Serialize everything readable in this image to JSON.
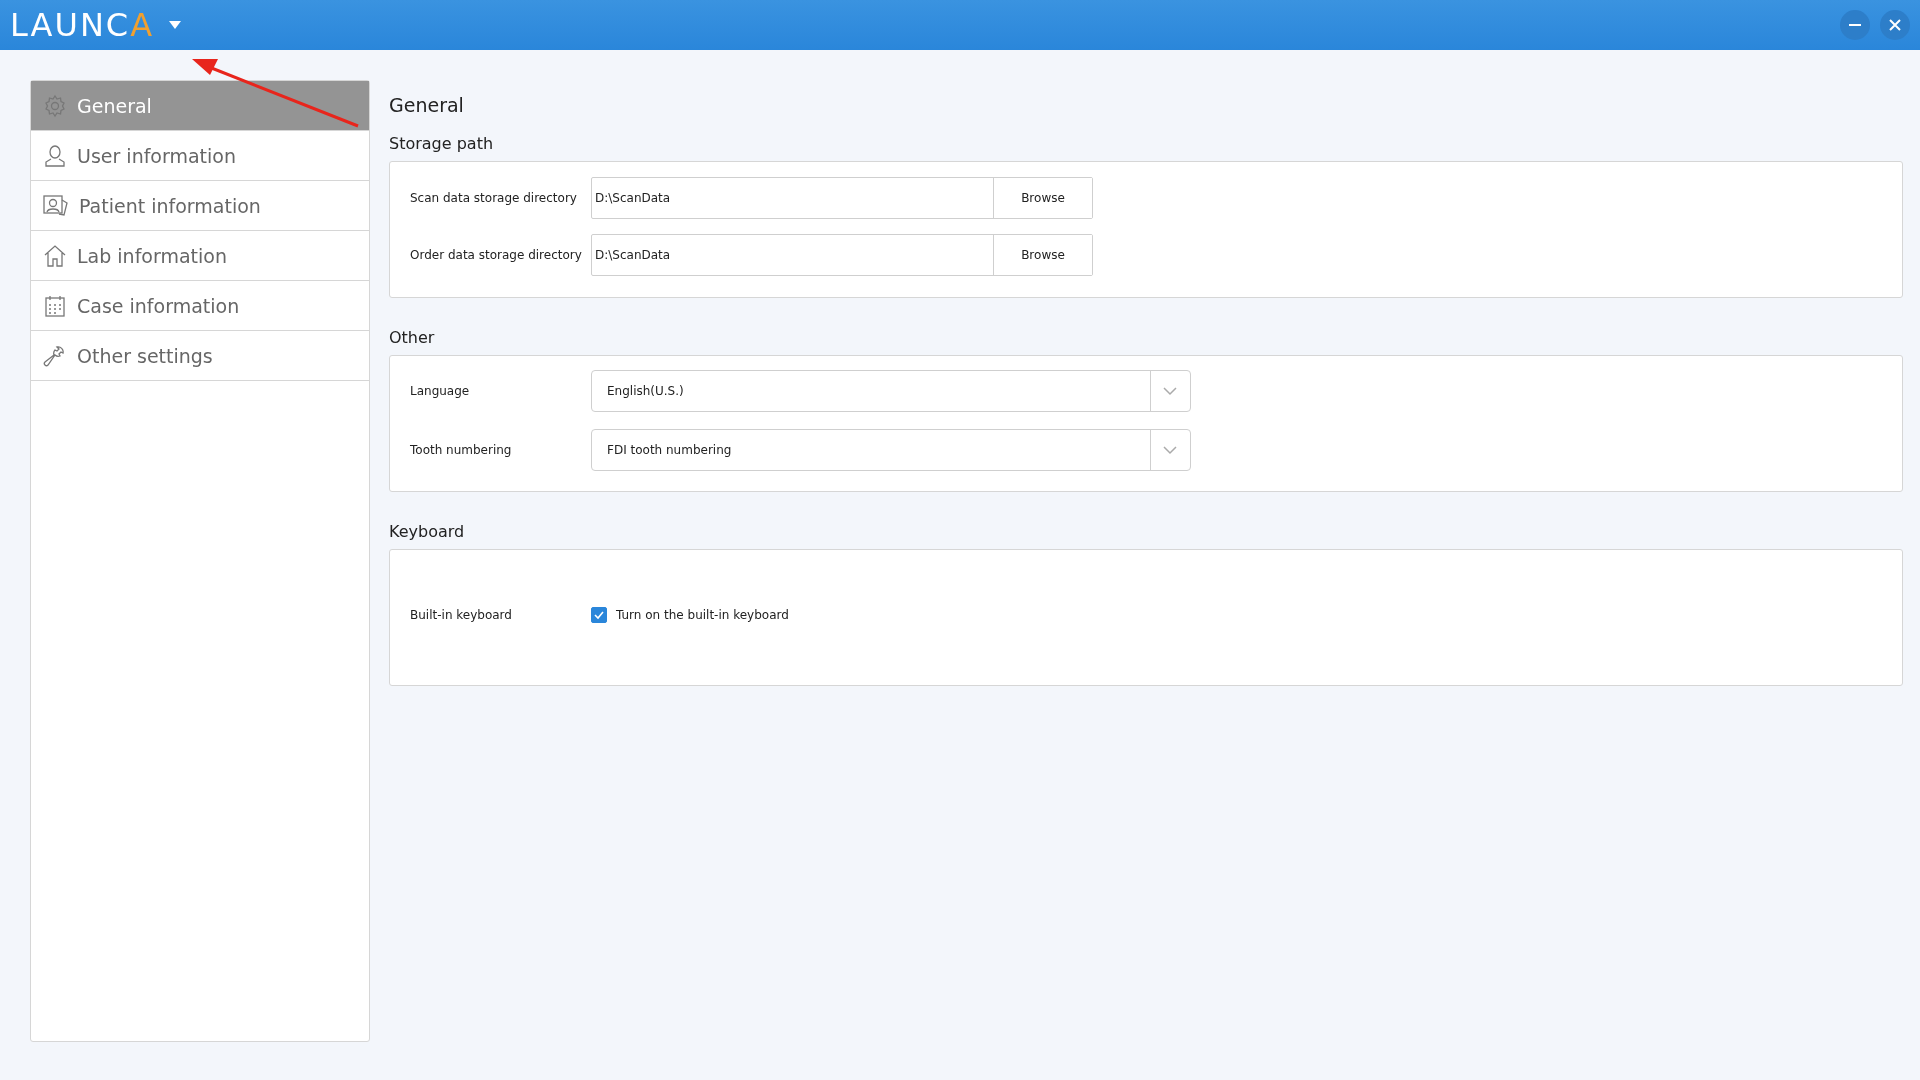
{
  "header": {
    "logo_main": "LAUNC",
    "logo_accent": "A"
  },
  "sidebar": {
    "items": [
      {
        "label": "General",
        "selected": true
      },
      {
        "label": "User information",
        "selected": false
      },
      {
        "label": "Patient information",
        "selected": false
      },
      {
        "label": "Lab information",
        "selected": false
      },
      {
        "label": "Case information",
        "selected": false
      },
      {
        "label": "Other settings",
        "selected": false
      }
    ]
  },
  "page_title": "General",
  "sections": [
    {
      "title": "Storage path",
      "rows": [
        {
          "kind": "path",
          "label": "Scan data storage directory",
          "value": "D:\\ScanData",
          "button": "Browse"
        },
        {
          "kind": "path",
          "label": "Order data storage directory",
          "value": "D:\\ScanData",
          "button": "Browse"
        }
      ]
    },
    {
      "title": "Other",
      "rows": [
        {
          "kind": "select",
          "label": "Language",
          "value": "English(U.S.)"
        },
        {
          "kind": "select",
          "label": "Tooth numbering",
          "value": "FDI tooth numbering"
        }
      ]
    },
    {
      "title": "Keyboard",
      "rows": [
        {
          "kind": "checkbox",
          "label": "Built-in keyboard",
          "option": "Turn on the built-in keyboard",
          "checked": true
        }
      ]
    }
  ]
}
